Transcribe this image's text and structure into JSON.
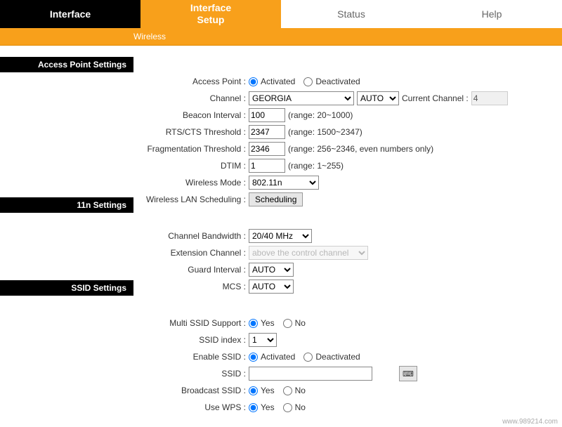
{
  "nav": {
    "interface": "Interface",
    "setup": "Interface\nSetup",
    "status": "Status",
    "help": "Help"
  },
  "subnav": {
    "wireless": "Wireless"
  },
  "sections": {
    "ap": "Access Point Settings",
    "n11": "11n Settings",
    "ssid": "SSID Settings"
  },
  "ap": {
    "access_point_label": "Access Point :",
    "activated": "Activated",
    "deactivated": "Deactivated",
    "channel_label": "Channel :",
    "country": "GEORGIA",
    "auto": "AUTO",
    "current_channel_label": "Current Channel :",
    "current_channel": "4",
    "beacon_label": "Beacon Interval :",
    "beacon": "100",
    "beacon_range": "(range: 20~1000)",
    "rts_label": "RTS/CTS Threshold :",
    "rts": "2347",
    "rts_range": "(range: 1500~2347)",
    "frag_label": "Fragmentation Threshold :",
    "frag": "2346",
    "frag_range": "(range: 256~2346, even numbers only)",
    "dtim_label": "DTIM :",
    "dtim": "1",
    "dtim_range": "(range: 1~255)",
    "wmode_label": "Wireless Mode :",
    "wmode": "802.11n",
    "sched_label": "Wireless LAN Scheduling :",
    "sched_button": "Scheduling"
  },
  "n11": {
    "bw_label": "Channel Bandwidth :",
    "bw": "20/40 MHz",
    "ext_label": "Extension Channel :",
    "ext": "above the control channel",
    "guard_label": "Guard Interval :",
    "guard": "AUTO",
    "mcs_label": "MCS :",
    "mcs": "AUTO"
  },
  "ssid": {
    "multi_label": "Multi SSID Support :",
    "yes": "Yes",
    "no": "No",
    "index_label": "SSID index :",
    "index": "1",
    "enable_label": "Enable SSID :",
    "activated": "Activated",
    "deactivated": "Deactivated",
    "ssid_label": "SSID :",
    "ssid_value": "",
    "broadcast_label": "Broadcast SSID :",
    "wps_label": "Use WPS :"
  },
  "host": "www.989214.com"
}
